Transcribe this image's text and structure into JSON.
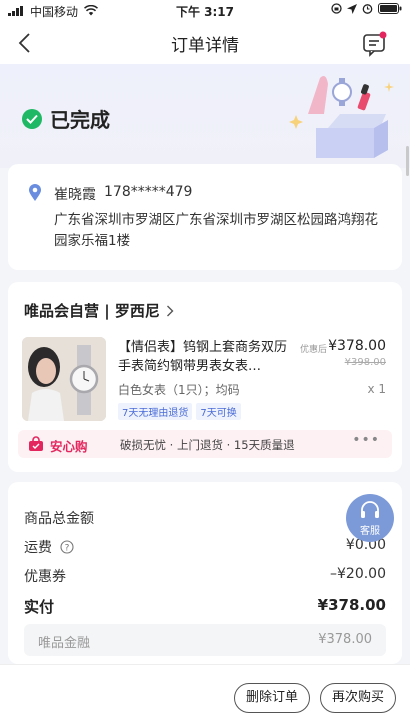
{
  "status_bar": {
    "carrier": "中国移动",
    "time": "下午 3:17"
  },
  "nav": {
    "title": "订单详情"
  },
  "order_status": {
    "label": "已完成"
  },
  "address": {
    "name": "崔晓霞",
    "phone": "178*****479",
    "line": "广东省深圳市罗湖区广东省深圳市罗湖区松园路鸿翔花园家乐福1楼"
  },
  "shop": {
    "name": "唯品会自营 | 罗西尼"
  },
  "product": {
    "title": "【情侣表】钨钢上套商务双历手表简约钢带男表女表…",
    "price_label": "优惠后",
    "price": "¥378.00",
    "original_price": "¥398.00",
    "spec": "白色女表（1只）；均码",
    "quantity": "x 1",
    "tags": [
      "7天无理由退货",
      "7天可换"
    ]
  },
  "assurance": {
    "name": "安心购",
    "desc": "破损无忧 · 上门退货 · 15天质量退"
  },
  "fees": {
    "goods_total_label": "商品总金额",
    "goods_total_value": "¥3",
    "shipping_label": "运费",
    "shipping_value": "¥0.00",
    "coupon_label": "优惠券",
    "coupon_value": "–¥20.00",
    "paid_label": "实付",
    "paid_value": "¥378.00",
    "finance_label": "唯品金融",
    "finance_value": "¥378.00"
  },
  "customer_service": {
    "label": "客服"
  },
  "actions": {
    "delete": "删除订单",
    "rebuy": "再次购买"
  },
  "colors": {
    "accent": "#e3265e",
    "success": "#1fb864",
    "link": "#4a6bd6"
  }
}
